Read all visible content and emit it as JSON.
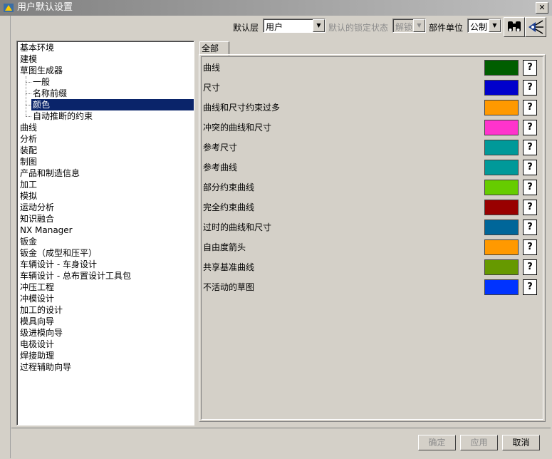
{
  "window": {
    "title": "用户默认设置",
    "close": "✕"
  },
  "toolbar": {
    "default_layer_label": "默认层",
    "default_layer_value": "用户",
    "lock_state_label": "默认的锁定状态",
    "lock_state_value": "解锁",
    "units_label": "部件单位",
    "units_value": "公制"
  },
  "tree": {
    "items": [
      {
        "label": "基本环境",
        "level": 0
      },
      {
        "label": "建模",
        "level": 0
      },
      {
        "label": "草图生成器",
        "level": 0
      },
      {
        "label": "一般",
        "level": 1
      },
      {
        "label": "名称前缀",
        "level": 1
      },
      {
        "label": "颜色",
        "level": 1,
        "selected": true
      },
      {
        "label": "自动推断的约束",
        "level": 1
      },
      {
        "label": "曲线",
        "level": 0
      },
      {
        "label": "分析",
        "level": 0
      },
      {
        "label": "装配",
        "level": 0
      },
      {
        "label": "制图",
        "level": 0
      },
      {
        "label": "产品和制造信息",
        "level": 0
      },
      {
        "label": "加工",
        "level": 0
      },
      {
        "label": "模拟",
        "level": 0
      },
      {
        "label": "运动分析",
        "level": 0
      },
      {
        "label": "知识融合",
        "level": 0
      },
      {
        "label": "NX Manager",
        "level": 0
      },
      {
        "label": "钣金",
        "level": 0
      },
      {
        "label": "钣金（成型和压平）",
        "level": 0
      },
      {
        "label": "车辆设计 - 车身设计",
        "level": 0
      },
      {
        "label": "车辆设计 - 总布置设计工具包",
        "level": 0
      },
      {
        "label": "冲压工程",
        "level": 0
      },
      {
        "label": "冲模设计",
        "level": 0
      },
      {
        "label": "加工的设计",
        "level": 0
      },
      {
        "label": "模具向导",
        "level": 0
      },
      {
        "label": "级进模向导",
        "level": 0
      },
      {
        "label": "电极设计",
        "level": 0
      },
      {
        "label": "焊接助理",
        "level": 0
      },
      {
        "label": "过程辅助向导",
        "level": 0
      }
    ]
  },
  "tabs": [
    {
      "label": "全部"
    }
  ],
  "colors": [
    {
      "label": "曲线",
      "color": "#005e00"
    },
    {
      "label": "尺寸",
      "color": "#0000cc"
    },
    {
      "label": "曲线和尺寸约束过多",
      "color": "#ff9900"
    },
    {
      "label": "冲突的曲线和尺寸",
      "color": "#ff33cc"
    },
    {
      "label": "参考尺寸",
      "color": "#009999"
    },
    {
      "label": "参考曲线",
      "color": "#009999"
    },
    {
      "label": "部分约束曲线",
      "color": "#66cc00"
    },
    {
      "label": "完全约束曲线",
      "color": "#990000"
    },
    {
      "label": "过时的曲线和尺寸",
      "color": "#006699"
    },
    {
      "label": "自由度箭头",
      "color": "#ff9900"
    },
    {
      "label": "共享基准曲线",
      "color": "#669900"
    },
    {
      "label": "不活动的草图",
      "color": "#0033ff"
    }
  ],
  "help_glyph": "?",
  "buttons": {
    "ok": "确定",
    "apply": "应用",
    "cancel": "取消"
  }
}
